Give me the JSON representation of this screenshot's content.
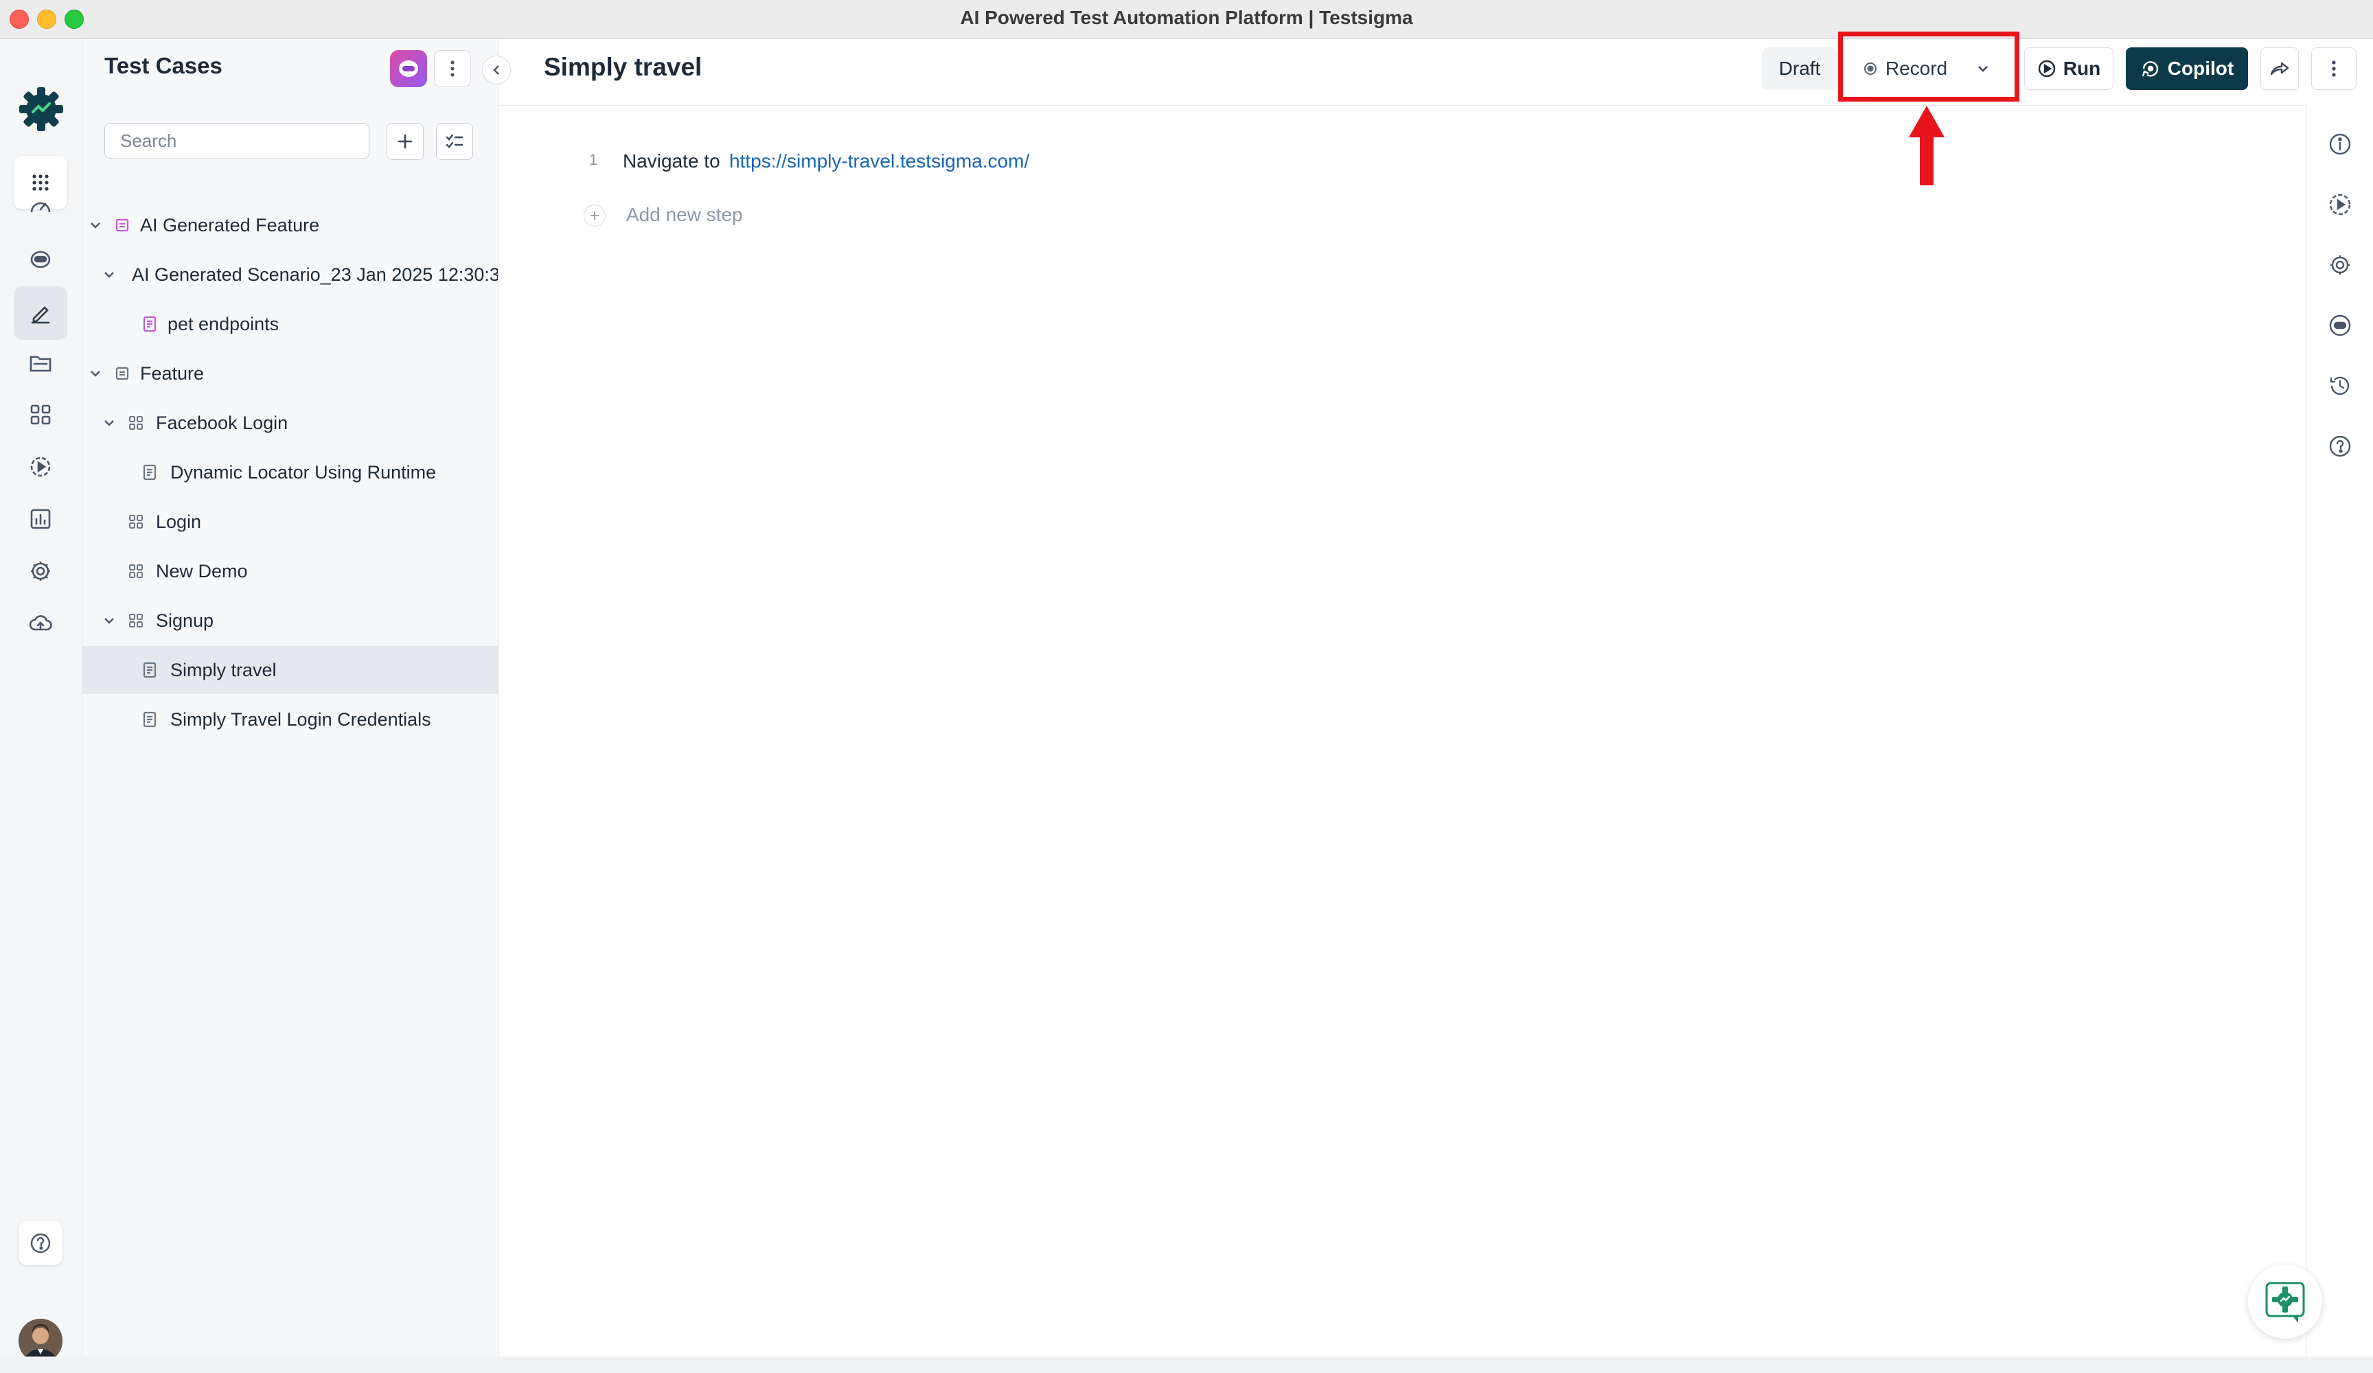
{
  "window": {
    "title": "AI Powered Test Automation Platform | Testsigma"
  },
  "sidebar": {
    "title": "Test Cases",
    "search_placeholder": "Search",
    "tree": [
      {
        "label": "AI Generated Feature",
        "type": "feature",
        "expanded": true
      },
      {
        "label": "AI Generated Scenario_23 Jan 2025 12:30:3",
        "type": "scenario",
        "expanded": true
      },
      {
        "label": "pet endpoints",
        "type": "test-case"
      },
      {
        "label": "Feature",
        "type": "feature",
        "expanded": true
      },
      {
        "label": "Facebook Login",
        "type": "scenario",
        "expanded": true
      },
      {
        "label": "Dynamic Locator Using Runtime",
        "type": "test-case"
      },
      {
        "label": "Login",
        "type": "scenario"
      },
      {
        "label": "New Demo",
        "type": "scenario"
      },
      {
        "label": "Signup",
        "type": "scenario",
        "expanded": true
      },
      {
        "label": "Simply travel",
        "type": "test-case",
        "selected": true
      },
      {
        "label": "Simply Travel Login Credentials",
        "type": "test-case"
      }
    ]
  },
  "header": {
    "title": "Simply travel",
    "status": "Draft",
    "record_label": "Record",
    "run_label": "Run",
    "copilot_label": "Copilot"
  },
  "steps": [
    {
      "number": "1",
      "action": "Navigate to",
      "url": "https://simply-travel.testsigma.com/"
    }
  ],
  "add_step_placeholder": "Add new step",
  "rail_icons": [
    "apps-grid-icon",
    "dashboard-icon",
    "copilot-bot-icon",
    "test-cases-icon",
    "folder-icon",
    "elements-icon",
    "run-icon",
    "reports-icon",
    "settings-icon",
    "cloud-icon"
  ],
  "right_rail_icons": [
    "info-icon",
    "runs-icon",
    "settings-icon",
    "ai-agent-icon",
    "history-icon",
    "help-icon"
  ],
  "colors": {
    "accent": "#0d3a4a",
    "highlight": "#e8141c",
    "link": "#1664b8",
    "brand": "#0f3e4c"
  }
}
